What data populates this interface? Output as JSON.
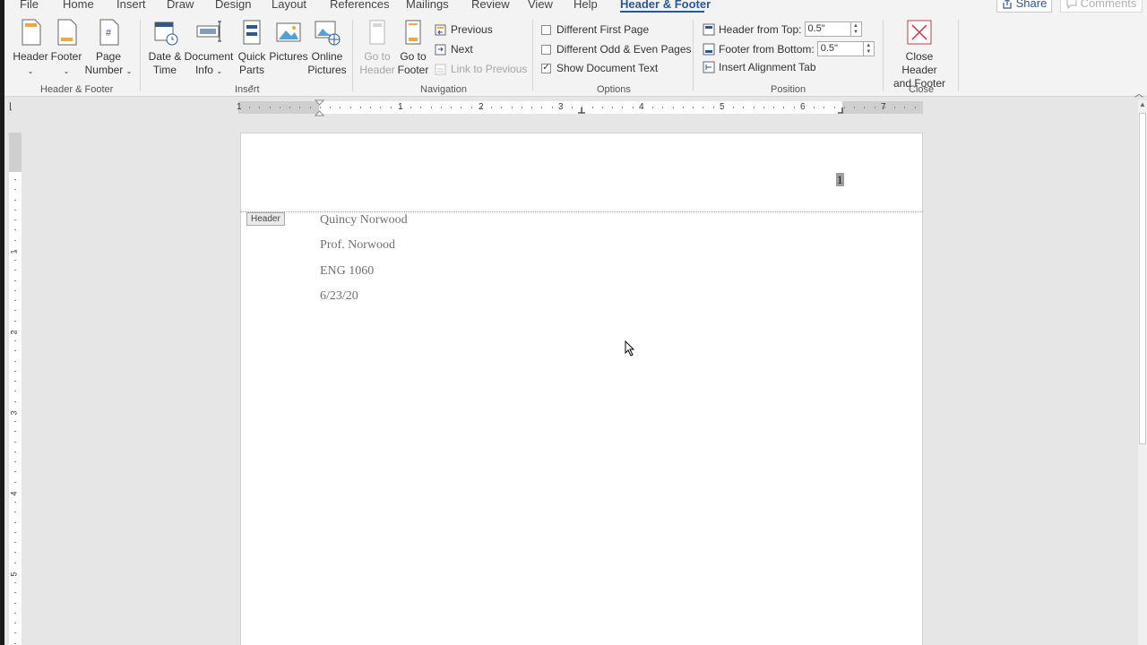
{
  "tabs": [
    "File",
    "Home",
    "Insert",
    "Draw",
    "Design",
    "Layout",
    "References",
    "Mailings",
    "Review",
    "View",
    "Help",
    "Header & Footer"
  ],
  "active_tab": "Header & Footer",
  "share_label": "Share",
  "comments_label": "Comments",
  "groups": {
    "header_footer": {
      "label": "Header & Footer",
      "header": "Header",
      "footer": "Footer",
      "page_number_1": "Page",
      "page_number_2": "Number"
    },
    "insert": {
      "label": "Insert",
      "date_time_1": "Date &",
      "date_time_2": "Time",
      "doc_info_1": "Document",
      "doc_info_2": "Info",
      "quick_parts_1": "Quick",
      "quick_parts_2": "Parts",
      "pictures": "Pictures",
      "online_pictures_1": "Online",
      "online_pictures_2": "Pictures"
    },
    "navigation": {
      "label": "Navigation",
      "go_to_header_1": "Go to",
      "go_to_header_2": "Header",
      "go_to_footer_1": "Go to",
      "go_to_footer_2": "Footer",
      "previous": "Previous",
      "next": "Next",
      "link_to_previous": "Link to Previous"
    },
    "options": {
      "label": "Options",
      "different_first_page": "Different First Page",
      "different_odd_even": "Different Odd & Even Pages",
      "show_document_text": "Show Document Text",
      "show_document_text_checked": true
    },
    "position": {
      "label": "Position",
      "header_from_top": "Header from Top:",
      "header_from_top_value": "0.5\"",
      "footer_from_bottom": "Footer from Bottom:",
      "footer_from_bottom_value": "0.5\"",
      "insert_alignment_tab": "Insert Alignment Tab"
    },
    "close": {
      "label": "Close",
      "close_1": "Close Header",
      "close_2": "and Footer"
    }
  },
  "ruler": {
    "h_numbers": [
      "1",
      "1",
      "2",
      "3",
      "4",
      "5",
      "6",
      "7"
    ],
    "v_numbers": [
      "1",
      "2",
      "3",
      "4",
      "5"
    ]
  },
  "document": {
    "header_tag": "Header",
    "page_number": "1",
    "lines": [
      "Quincy Norwood",
      "Prof. Norwood",
      "ENG 1060",
      "6/23/20"
    ]
  },
  "colors": {
    "accent": "#2b579a",
    "close_red": "#d13438"
  }
}
